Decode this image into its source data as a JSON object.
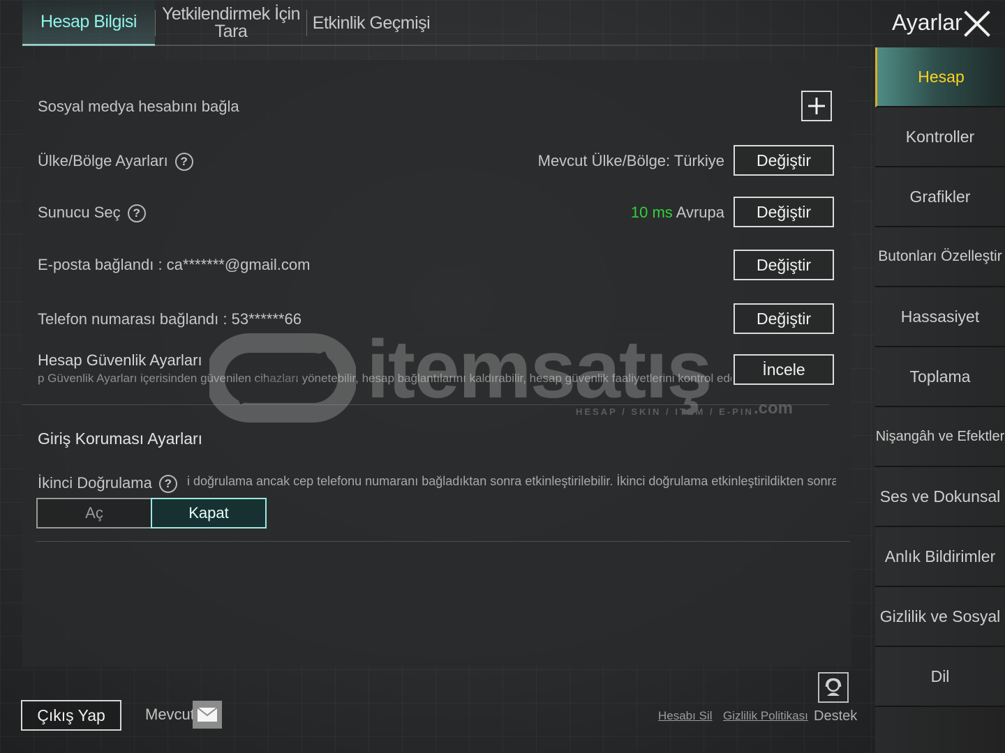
{
  "header": {
    "title": "Ayarlar",
    "close_icon": "close-icon"
  },
  "tabs": [
    {
      "label": "Hesap Bilgisi",
      "active": true
    },
    {
      "label_line1": "Yetkilendirmek İçin",
      "label_line2": "Tara"
    },
    {
      "label": "Etkinlik Geçmişi"
    }
  ],
  "account": {
    "social_label": "Sosyal medya hesabını bağla",
    "social_add_icon": "plus-icon",
    "region_label": "Ülke/Bölge Ayarları",
    "region_current": "Mevcut Ülke/Bölge: Türkiye",
    "region_button": "Değiştir",
    "server_label": "Sunucu Seç",
    "server_ping": "10 ms",
    "server_region": "Avrupa",
    "server_button": "Değiştir",
    "email_label": "E-posta bağlandı : ca*******@gmail.com",
    "email_button": "Değiştir",
    "phone_label": "Telefon numarası bağlandı : 53******66",
    "phone_button": "Değiştir",
    "security_title": "Hesap Güvenlik Ayarları",
    "security_desc": "p Güvenlik Ayarları içerisinden güvenilen cihazları yönetebilir, hesap bağlantılarını kaldırabilir, hesap güvenlik faaliyetlerini kontrol edebilir ve",
    "security_button": "İncele"
  },
  "login_protection": {
    "title": "Giriş Koruması Ayarları",
    "twofa_label": "İkinci Doğrulama",
    "twofa_desc": "i doğrulama ancak cep telefonu numaranı bağladıktan sonra etkinleştirilebilir. İkinci doğrulama etkinleştirildikten sonra, güvenilm",
    "option_on": "Aç",
    "option_off": "Kapat",
    "selected": "Kapat"
  },
  "watermark": {
    "brand": "itemsatış",
    "tagline": "HESAP / SKIN / ITEM / E-PIN",
    "domain": ".com"
  },
  "footer": {
    "logout": "Çıkış Yap",
    "mevcut": "Mevcut",
    "mail_icon": "mail-icon",
    "delete_account": "Hesabı Sil",
    "privacy_policy": "Gizlilik Politikası",
    "support": "Destek",
    "support_icon": "support-icon"
  },
  "sidebar": {
    "items": [
      {
        "label": "Hesap",
        "active": true
      },
      {
        "label": "Kontroller"
      },
      {
        "label": "Grafikler"
      },
      {
        "label": "Butonları Özelleştir"
      },
      {
        "label": "Hassasiyet"
      },
      {
        "label": "Toplama"
      },
      {
        "label": "Nişangâh ve Efektler"
      },
      {
        "label": "Ses ve Dokunsal"
      },
      {
        "label": "Anlık Bildirimler"
      },
      {
        "label": "Gizlilik ve Sosyal"
      },
      {
        "label": "Dil"
      }
    ]
  },
  "colors": {
    "accent_teal": "#9fe8e0",
    "active_sidebar_text": "#ffd21f",
    "ping_green": "#32d13a"
  }
}
